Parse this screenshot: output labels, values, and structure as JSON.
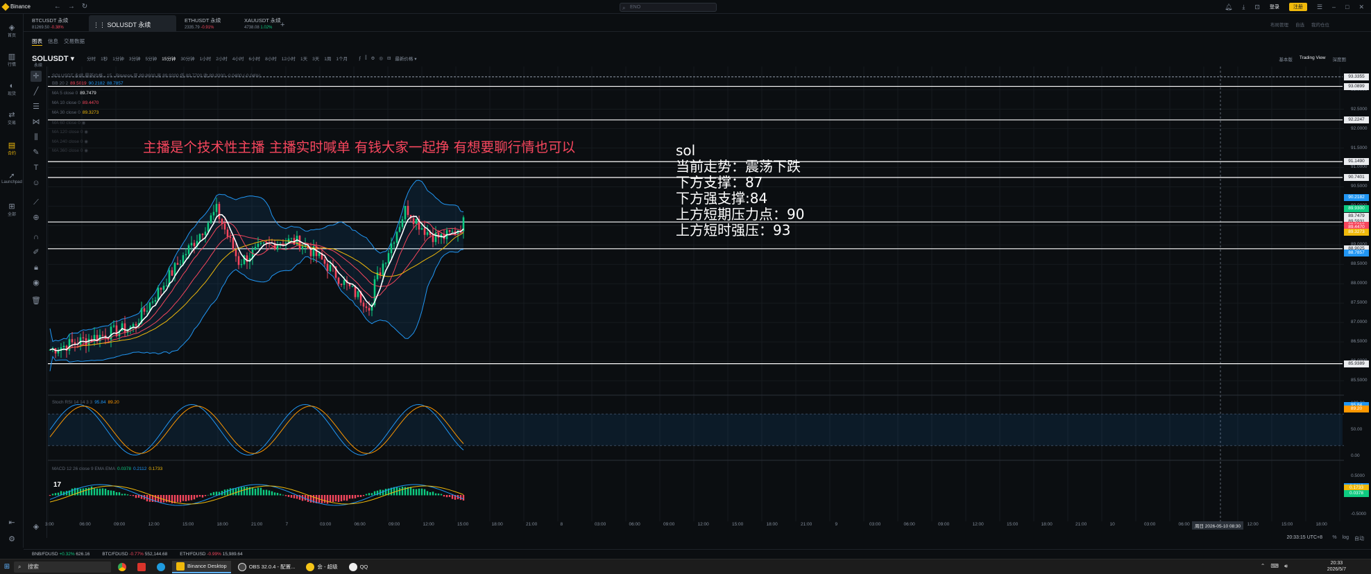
{
  "window": {
    "app_name": "Binance",
    "search_placeholder": "ENO",
    "login": "登录",
    "register": "注册"
  },
  "sidebar": {
    "items": [
      {
        "label": "首页",
        "icon": "binance-logo-icon"
      },
      {
        "label": "行情",
        "icon": "bar-chart-icon"
      },
      {
        "label": "现货",
        "icon": "spot-icon"
      },
      {
        "label": "交易",
        "icon": "exchange-icon"
      },
      {
        "label": "合约",
        "icon": "futures-icon"
      },
      {
        "label": "Launchpad",
        "icon": "rocket-icon"
      },
      {
        "label": "全部",
        "icon": "grid-icon"
      }
    ]
  },
  "tabs": [
    {
      "name": "BTCUSDT 永续",
      "price": "81269.50",
      "change": "-0.38%"
    },
    {
      "name": "SOLUSDT 永续",
      "price": "",
      "change": ""
    },
    {
      "name": "ETHUSDT 永续",
      "price": "2335.79",
      "change": "-0.91%"
    },
    {
      "name": "XAUUSDT 永续",
      "price": "4738.08",
      "change": "1.02%"
    }
  ],
  "right_links": [
    "布局管理",
    "自选",
    "我的仓位"
  ],
  "subtabs": [
    "图表",
    "信息",
    "交易数据"
  ],
  "symbol": {
    "name": "SOLUSDT",
    "type": "永续"
  },
  "timeframes": [
    "分时",
    "1秒",
    "1分钟",
    "3分钟",
    "5分钟",
    "15分钟",
    "30分钟",
    "1小时",
    "2小时",
    "4小时",
    "6小时",
    "8小时",
    "12小时",
    "1天",
    "3天",
    "1周",
    "1个月"
  ],
  "active_timeframe": "15分钟",
  "price_type": "最新价格",
  "views": [
    "基本版",
    "Trading View",
    "深度图"
  ],
  "legend": {
    "title": "SOLUSDT 永续 最新价格 · 15 · Binance",
    "ohlc": "开 89.8600 高 89.9200 低 89.7700 收 89.9300 -0.0400 (-0.04%)",
    "bb": {
      "label": "BB 20 2",
      "v1": "89.5019",
      "v2": "90.2182",
      "v3": "88.7857"
    },
    "ma5": {
      "label": "MA 5 close 0",
      "value": "89.7479"
    },
    "ma10": {
      "label": "MA 10 close 0",
      "value": "89.4470"
    },
    "ma30": {
      "label": "MA 30 close 0",
      "value": "89.3273"
    },
    "hidden": [
      "MA 60 close 0",
      "MA 120 close 0",
      "MA 240 close 0",
      "MA 360 close 0"
    ]
  },
  "overlay_text": "主播是个技术性主播 主播实时喊单 有钱大家一起挣 有想要聊行情也可以",
  "note": {
    "lines": [
      "sol",
      "当前走势：震荡下跌",
      "下方支撑：87",
      "下方强支撑:84",
      "上方短期压力点：90",
      "上方短时强压：93"
    ]
  },
  "price_axis": {
    "ticks": [
      "93.0000",
      "92.5000",
      "92.0000",
      "91.5000",
      "91.0000",
      "90.5000",
      "90.0000",
      "89.5000",
      "89.0000",
      "88.5000",
      "88.0000",
      "87.5000",
      "87.0000",
      "86.5000",
      "86.0000",
      "85.5000"
    ],
    "labels": [
      {
        "value": "93.3355",
        "color": "#eaecef"
      },
      {
        "value": "93.0899",
        "color": "#eaecef"
      },
      {
        "value": "92.2247",
        "color": "#eaecef"
      },
      {
        "value": "91.1490",
        "color": "#eaecef"
      },
      {
        "value": "90.7401",
        "color": "#eaecef"
      },
      {
        "value": "90.2182",
        "color": "#2196f3"
      },
      {
        "value": "89.9300",
        "color": "#0ecb81"
      },
      {
        "value": "89.7479",
        "color": "#eaecef"
      },
      {
        "value": "89.5931",
        "color": "#eaecef"
      },
      {
        "value": "89.5019",
        "color": "#f6465d"
      },
      {
        "value": "89.4470",
        "color": "#f6465d"
      },
      {
        "value": "89.3273",
        "color": "#f0b90b"
      },
      {
        "value": "88.9025",
        "color": "#eaecef"
      },
      {
        "value": "88.7857",
        "color": "#2196f3"
      },
      {
        "value": "85.9389",
        "color": "#eaecef"
      }
    ]
  },
  "stoch": {
    "label": "Stoch RSI 14 14 3 3",
    "k": "95.84",
    "d": "89.20",
    "ticks": [
      "100.00",
      "50.00",
      "0.00"
    ]
  },
  "macd": {
    "label": "MACD 12 26 close 9 EMA EMA",
    "v1": "0.0378",
    "v2": "0.2112",
    "v3": "0.1733",
    "ticks": [
      "0.5000",
      "0.0000",
      "-0.5000"
    ]
  },
  "time_axis": [
    "3:00",
    "06:00",
    "09:00",
    "12:00",
    "15:00",
    "18:00",
    "21:00",
    "7",
    "03:00",
    "06:00",
    "09:00",
    "12:00",
    "15:00",
    "18:00",
    "21:00",
    "8",
    "03:00",
    "06:00",
    "09:00",
    "12:00",
    "15:00",
    "18:00",
    "21:00",
    "9",
    "03:00",
    "06:00",
    "09:00",
    "12:00",
    "15:00",
    "18:00",
    "21:00",
    "10",
    "03:00",
    "06:00",
    "09:00",
    "12:00",
    "15:00",
    "18:00"
  ],
  "crosshair_time": "周日 2026-05-10   08:30",
  "timezone": "20:33:15 UTC+8",
  "scale_opts": [
    "%",
    "log",
    "自动"
  ],
  "ticker": [
    {
      "sym": "BNB/FDUSD",
      "chg": "+0.32%",
      "price": "626.16",
      "up": true
    },
    {
      "sym": "BTC/FDUSD",
      "chg": "-0.77%",
      "price": "552,144.68",
      "up": false
    },
    {
      "sym": "ETH/FDUSD",
      "chg": "-0.99%",
      "price": "15,989.64",
      "up": false
    }
  ],
  "taskbar": {
    "search": "搜索",
    "apps": [
      "Binance Desktop",
      "OBS 32.0.4 - 配置...",
      "会 - 超级",
      "QQ"
    ],
    "time": "20:33",
    "date": "2026/5/7"
  },
  "colors": {
    "up": "#0ecb81",
    "down": "#f6465d",
    "accent": "#f0b90b",
    "bg": "#0b0e11"
  }
}
